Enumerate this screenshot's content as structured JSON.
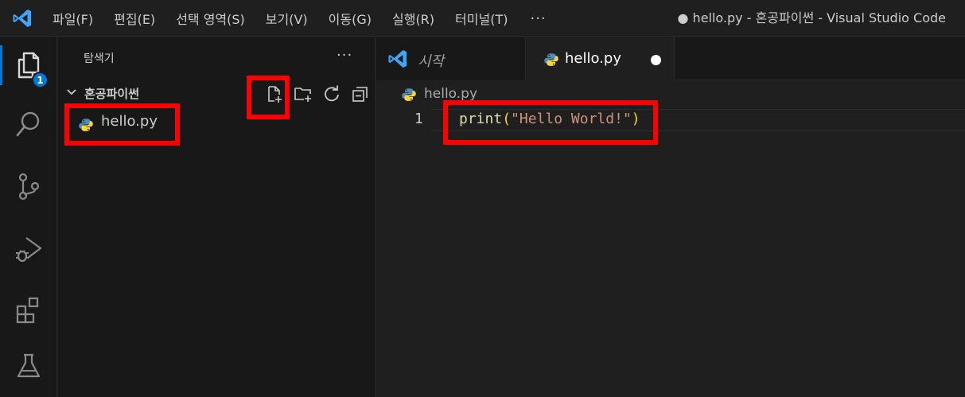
{
  "titlebar": {
    "menu": [
      "파일(F)",
      "편집(E)",
      "선택 영역(S)",
      "보기(V)",
      "이동(G)",
      "실행(R)",
      "터미널(T)"
    ],
    "more": "···",
    "window_title": "● hello.py - 혼공파이썬 - Visual Studio Code"
  },
  "activity_bar": {
    "items": [
      "explorer-icon",
      "search-icon",
      "source-control-icon",
      "run-debug-icon",
      "extensions-icon",
      "testing-icon"
    ],
    "explorer_badge": "1",
    "accent_color": "#0078d4"
  },
  "sidebar": {
    "title": "탐색기",
    "more": "···",
    "folder_name": "혼공파이썬",
    "folder_actions": [
      "new-file-icon",
      "new-folder-icon",
      "refresh-icon",
      "collapse-all-icon"
    ],
    "files": [
      "hello.py"
    ]
  },
  "tabs": [
    {
      "label": "시작",
      "icon": "vscode-logo-icon",
      "active": false
    },
    {
      "label": "hello.py",
      "icon": "python-file-icon",
      "active": true,
      "dirty": true
    }
  ],
  "editor": {
    "breadcrumb": "hello.py",
    "lines": [
      {
        "number": "1",
        "fn": "print",
        "open": "(",
        "string": "\"Hello World!\"",
        "close": ")"
      }
    ]
  },
  "colors": {
    "highlight": "#ff0000",
    "python_blue": "#4b8bbe",
    "python_yellow": "#ffd43b"
  }
}
